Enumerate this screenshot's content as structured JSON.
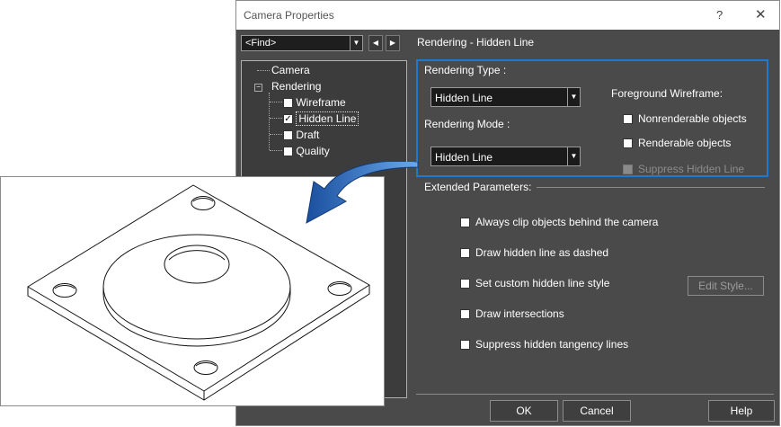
{
  "window": {
    "title": "Camera Properties",
    "help_glyph": "?",
    "close_glyph": "✕"
  },
  "find": {
    "value": "<Find>"
  },
  "panel_title": "Rendering - Hidden Line",
  "tree": {
    "camera": "Camera",
    "rendering": "Rendering",
    "expander": "−",
    "items": [
      {
        "label": "Wireframe",
        "checked": ""
      },
      {
        "label": "Hidden Line",
        "checked": "✓"
      },
      {
        "label": "Draft",
        "checked": ""
      },
      {
        "label": "Quality",
        "checked": ""
      }
    ]
  },
  "rendering_type": {
    "label": "Rendering Type :",
    "value": "Hidden Line"
  },
  "rendering_mode": {
    "label": "Rendering Mode :",
    "value": "Hidden Line"
  },
  "foreground": {
    "label": "Foreground Wireframe:",
    "options": [
      "Nonrenderable objects",
      "Renderable objects",
      "Suppress Hidden Line"
    ]
  },
  "extended": {
    "label": "Extended Parameters:",
    "options": [
      "Always clip objects behind the camera",
      "Draw hidden line as dashed",
      "Set custom hidden line style",
      "Draw intersections",
      "Suppress hidden tangency lines"
    ],
    "edit_style": "Edit Style..."
  },
  "buttons": {
    "ok": "OK",
    "cancel": "Cancel",
    "help": "Help"
  },
  "colors": {
    "dialog_bg": "#4a4a4a",
    "highlight_border": "#1e7ad0",
    "arrow": "#2a6fc9"
  }
}
